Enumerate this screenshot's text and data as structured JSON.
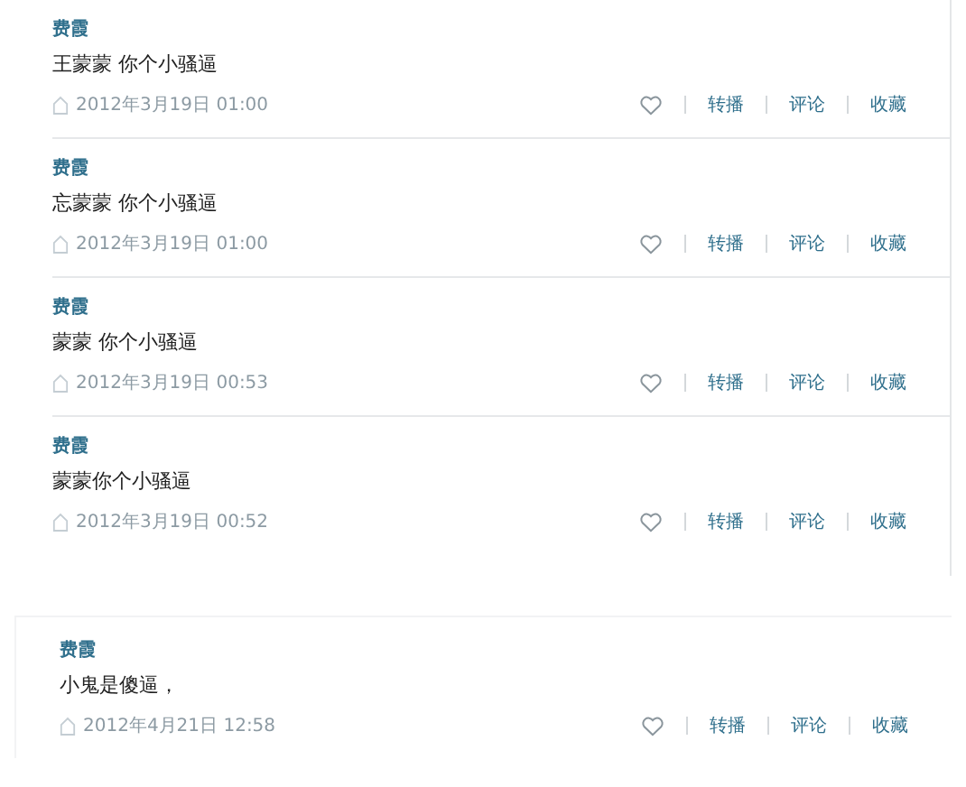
{
  "panels": [
    {
      "posts": [
        {
          "author": "费霞",
          "text": "王蒙蒙 你个小骚逼",
          "time": "2012年3月19日 01:00",
          "actions": [
            "转播",
            "评论",
            "收藏"
          ]
        },
        {
          "author": "费霞",
          "text": "忘蒙蒙 你个小骚逼",
          "time": "2012年3月19日 01:00",
          "actions": [
            "转播",
            "评论",
            "收藏"
          ]
        },
        {
          "author": "费霞",
          "text": "蒙蒙 你个小骚逼",
          "time": "2012年3月19日 00:53",
          "actions": [
            "转播",
            "评论",
            "收藏"
          ]
        },
        {
          "author": "费霞",
          "text": "蒙蒙你个小骚逼",
          "time": "2012年3月19日 00:52",
          "actions": [
            "转播",
            "评论",
            "收藏"
          ]
        }
      ]
    },
    {
      "posts": [
        {
          "author": "费霞",
          "text": "小鬼是傻逼，",
          "time": "2012年4月21日 12:58",
          "actions": [
            "转播",
            "评论",
            "收藏"
          ]
        }
      ]
    }
  ]
}
